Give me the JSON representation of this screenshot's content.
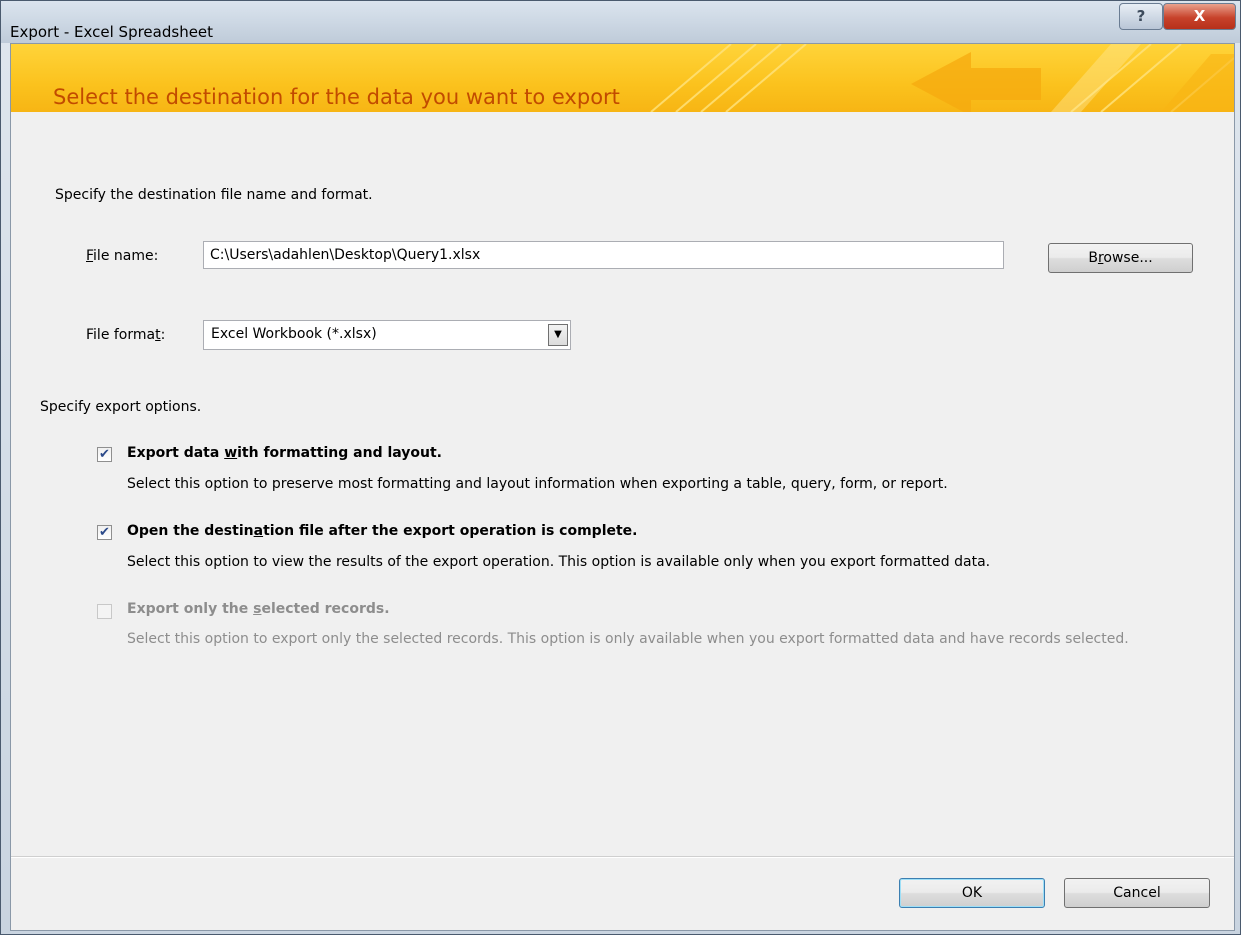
{
  "window": {
    "title": "Export - Excel Spreadsheet",
    "help_glyph": "?",
    "close_glyph": "X"
  },
  "banner": {
    "title": "Select the destination for the data you want to export"
  },
  "destination": {
    "heading": "Specify the destination file name and format.",
    "file_name_label": "File name:",
    "file_name_value": "C:\\Users\\adahlen\\Desktop\\Query1.xlsx",
    "browse_label": "Browse...",
    "file_format_label": "File format:",
    "file_format_value": "Excel Workbook (*.xlsx)"
  },
  "options": {
    "heading": "Specify export options.",
    "items": [
      {
        "title": "Export data with formatting and layout.",
        "description": "Select this option to preserve most formatting and layout information when exporting a table, query, form, or report.",
        "checked": true,
        "enabled": true
      },
      {
        "title": "Open the destination file after the export operation is complete.",
        "description": "Select this option to view the results of the export operation. This option is available only when you export formatted data.",
        "checked": true,
        "enabled": true
      },
      {
        "title": "Export only the selected records.",
        "description": "Select this option to export only the selected records. This option is only available when you export formatted data and have records selected.",
        "checked": false,
        "enabled": false
      }
    ]
  },
  "footer": {
    "ok_label": "OK",
    "cancel_label": "Cancel"
  },
  "colors": {
    "banner_yellow": "#fbc21d",
    "banner_title": "#c24b00",
    "close_red": "#c7422b"
  }
}
